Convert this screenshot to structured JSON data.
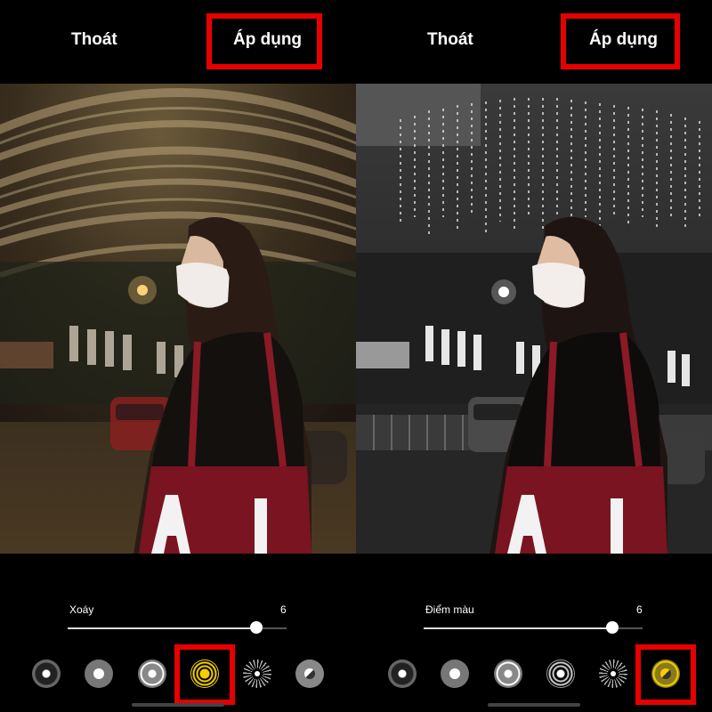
{
  "left": {
    "header": {
      "exit_label": "Thoát",
      "apply_label": "Áp dụng"
    },
    "slider": {
      "label": "Xoáy",
      "value": "6",
      "fill_fraction": 0.86
    },
    "tools": [
      "solid-dot-icon",
      "diamond-dot-icon",
      "soft-ring-dot-icon",
      "swirl-rings-icon",
      "radial-burst-icon",
      "color-point-icon"
    ],
    "selected_tool": 3
  },
  "right": {
    "header": {
      "exit_label": "Thoát",
      "apply_label": "Áp dụng"
    },
    "slider": {
      "label": "Điểm màu",
      "value": "6",
      "fill_fraction": 0.86
    },
    "tools": [
      "solid-dot-icon",
      "diamond-dot-icon",
      "soft-ring-dot-icon",
      "swirl-rings-icon",
      "radial-burst-icon",
      "color-point-icon"
    ],
    "selected_tool": 5
  },
  "colors": {
    "highlight": "#e60000",
    "accent_yellow": "#f5d000",
    "background": "#000000"
  }
}
